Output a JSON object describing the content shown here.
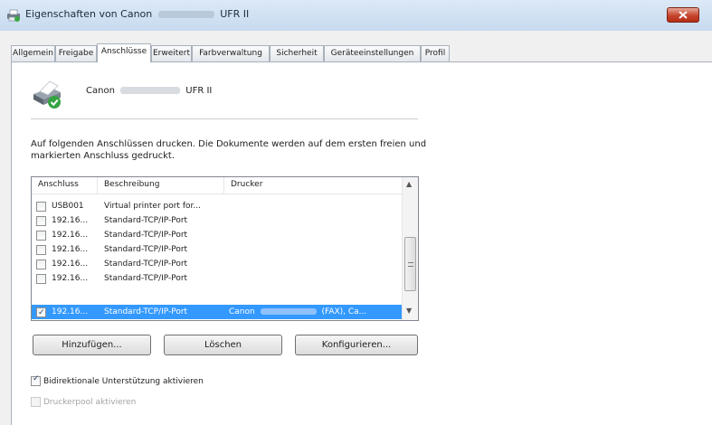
{
  "window": {
    "title_prefix": "Eigenschaften von Canon",
    "title_suffix": "UFR II"
  },
  "tabs": [
    {
      "label": "Allgemein",
      "active": false
    },
    {
      "label": "Freigabe",
      "active": false
    },
    {
      "label": "Anschlüsse",
      "active": true
    },
    {
      "label": "Erweitert",
      "active": false
    },
    {
      "label": "Farbverwaltung",
      "active": false
    },
    {
      "label": "Sicherheit",
      "active": false
    },
    {
      "label": "Geräteeinstellungen",
      "active": false
    },
    {
      "label": "Profil",
      "active": false
    }
  ],
  "printer": {
    "name_prefix": "Canon",
    "name_suffix": "UFR II",
    "icon": "printer-default-check-icon"
  },
  "description": "Auf folgenden Anschlüssen drucken. Die Dokumente werden auf dem ersten freien und markierten Anschluss gedruckt.",
  "port_list": {
    "columns": [
      "Anschluss",
      "Beschreibung",
      "Drucker"
    ],
    "rows": [
      {
        "port": "USB001",
        "description": "Virtual printer port for...",
        "printer": "",
        "checked": false,
        "selected": false
      },
      {
        "port": "192.16...",
        "description": "Standard-TCP/IP-Port",
        "printer": "",
        "checked": false,
        "selected": false
      },
      {
        "port": "192.16...",
        "description": "Standard-TCP/IP-Port",
        "printer": "",
        "checked": false,
        "selected": false
      },
      {
        "port": "192.16...",
        "description": "Standard-TCP/IP-Port",
        "printer": "",
        "checked": false,
        "selected": false
      },
      {
        "port": "192.16...",
        "description": "Standard-TCP/IP-Port",
        "printer": "",
        "checked": false,
        "selected": false
      },
      {
        "port": "192.16...",
        "description": "Standard-TCP/IP-Port",
        "printer": "",
        "checked": false,
        "selected": false
      },
      {
        "port": "192.16...",
        "description": "Standard-TCP/IP-Port",
        "printer_prefix": "Canon",
        "printer_suffix": "(FAX), Ca...",
        "checked": true,
        "selected": true
      }
    ],
    "selection_color": "#3399ff"
  },
  "buttons": {
    "add": "Hinzufügen...",
    "delete": "Löschen",
    "configure": "Konfigurieren..."
  },
  "options": {
    "bidirectional": {
      "label": "Bidirektionale Unterstützung aktivieren",
      "checked": true,
      "enabled": true
    },
    "pool": {
      "label": "Druckerpool aktivieren",
      "checked": false,
      "enabled": false
    }
  }
}
